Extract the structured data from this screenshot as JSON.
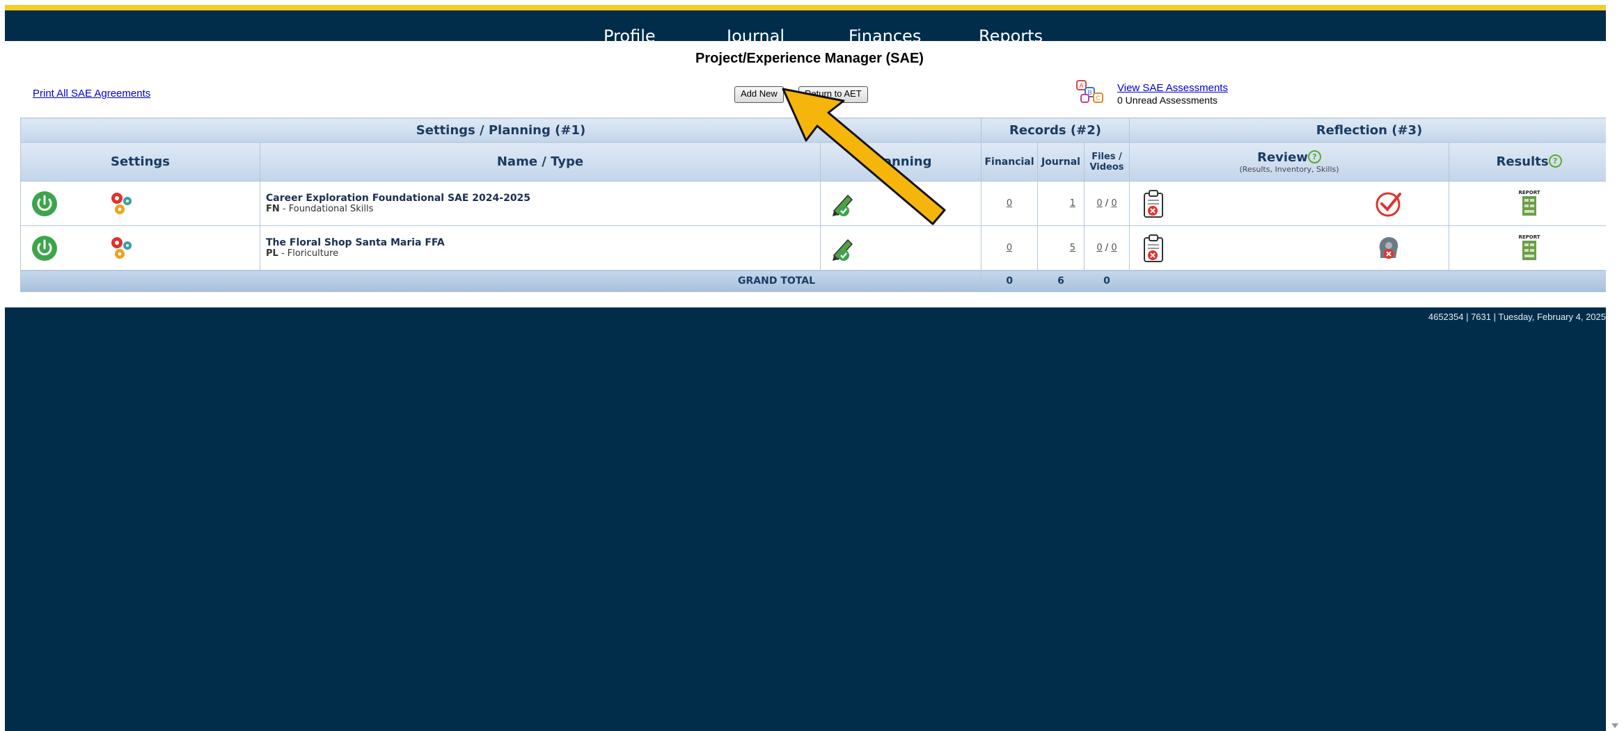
{
  "nav": {
    "items": [
      "Profile",
      "Journal",
      "Finances",
      "Reports"
    ]
  },
  "page_title": "Project/Experience Manager (SAE)",
  "toolbar": {
    "print_link": "Print All SAE Agreements",
    "add_new": "Add New",
    "return_aet": "Return to AET",
    "assessments_link": "View SAE Assessments",
    "unread": "0 Unread Assessments"
  },
  "table": {
    "group_headers": {
      "settings_planning": "Settings / Planning (#1)",
      "records": "Records (#2)",
      "reflection": "Reflection (#3)"
    },
    "columns": {
      "settings": "Settings",
      "name_type": "Name / Type",
      "planning": "Planning",
      "financial": "Financial",
      "journal": "Journal",
      "files_videos": "Files / Videos",
      "review": "Review",
      "review_sub": "(Results, Inventory, Skills)",
      "results": "Results"
    },
    "rows": [
      {
        "name": "Career Exploration Foundational SAE 2024-2025",
        "type_code": "FN",
        "type_label": " - Foundational Skills",
        "financial": "0",
        "journal": "1",
        "files": "0",
        "videos": "0",
        "review_status": "complete"
      },
      {
        "name": "The Floral Shop Santa Maria FFA",
        "type_code": "PL",
        "type_label": " - Floriculture",
        "financial": "0",
        "journal": "5",
        "files": "0",
        "videos": "0",
        "review_status": "incomplete"
      }
    ],
    "totals": {
      "label": "GRAND TOTAL",
      "financial": "0",
      "journal": "6",
      "files": "0"
    }
  },
  "footer": {
    "info": "4652354 | 7631 | Tuesday, February 4, 2025"
  },
  "colors": {
    "navy": "#012d4b",
    "gold": "#f2cd2c",
    "header_blue": "#c3d5ea",
    "arrow": "#f5b50a"
  }
}
